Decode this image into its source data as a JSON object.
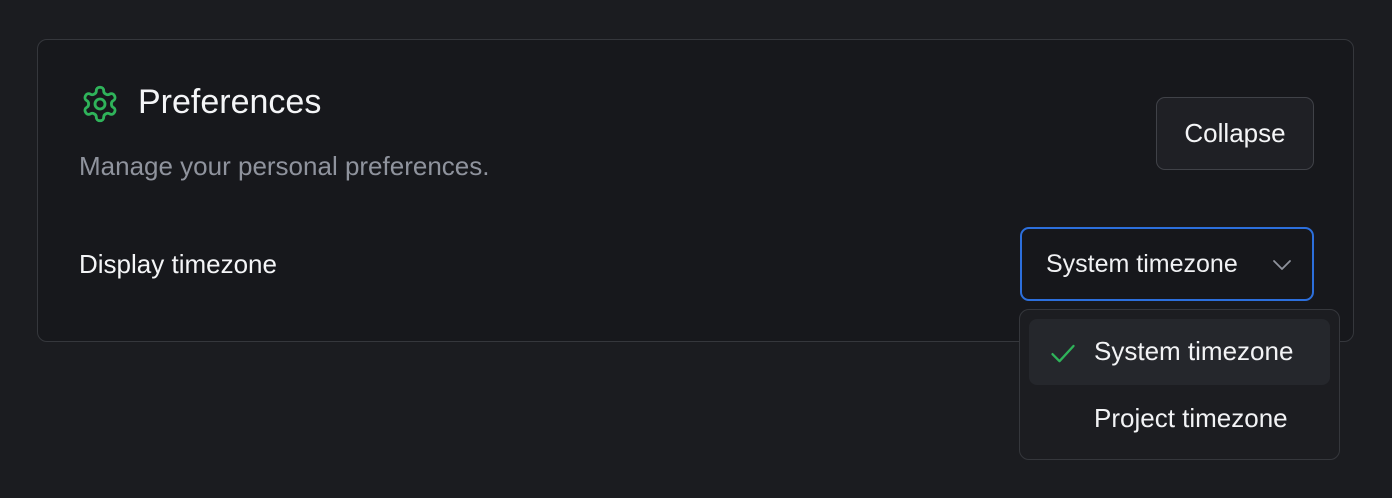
{
  "colors": {
    "accent_green": "#2fb35a",
    "focus_blue": "#2c6fdc",
    "background": "#1b1c20",
    "card_background": "#17181c",
    "muted_text": "#8f939d"
  },
  "card": {
    "icon": "gear-icon",
    "title": "Preferences",
    "subtitle": "Manage your personal preferences.",
    "collapse_label": "Collapse"
  },
  "timezone": {
    "label": "Display timezone",
    "selected_value": "System timezone",
    "chevron_icon": "chevron-down-icon",
    "options": [
      {
        "label": "System timezone",
        "selected": true,
        "icon": "check-icon"
      },
      {
        "label": "Project timezone",
        "selected": false
      }
    ]
  }
}
